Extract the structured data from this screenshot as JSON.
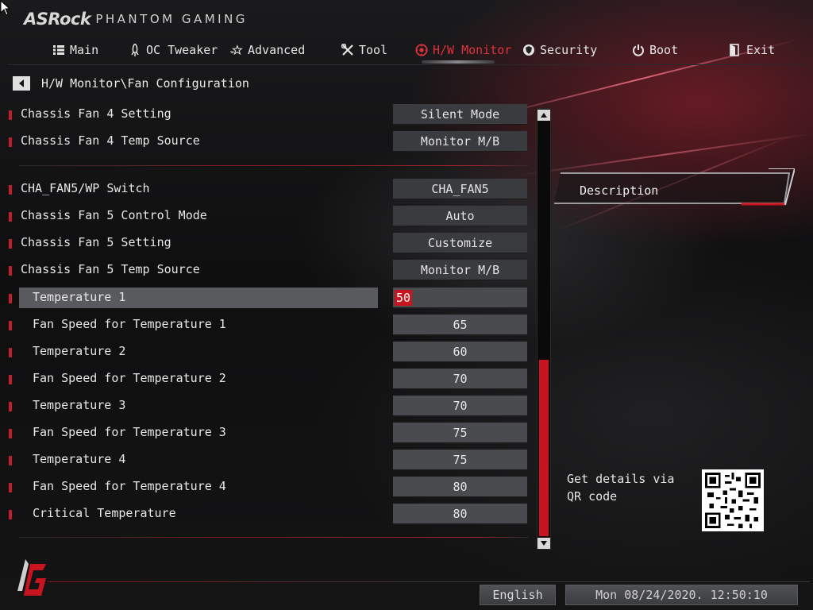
{
  "brand": {
    "name": "ASRock",
    "subtitle": "PHANTOM GAMING"
  },
  "nav": [
    {
      "label": "Main",
      "icon": "list-icon"
    },
    {
      "label": "OC Tweaker",
      "icon": "rocket-icon"
    },
    {
      "label": "Advanced",
      "icon": "star-icon"
    },
    {
      "label": "Tool",
      "icon": "tools-icon"
    },
    {
      "label": "H/W Monitor",
      "icon": "monitor-gauge-icon",
      "active": true
    },
    {
      "label": "Security",
      "icon": "shield-icon"
    },
    {
      "label": "Boot",
      "icon": "power-icon"
    },
    {
      "label": "Exit",
      "icon": "exit-icon"
    }
  ],
  "breadcrumb": "H/W Monitor\\Fan Configuration",
  "settings": [
    {
      "label": "Chassis Fan 4 Setting",
      "value": "Silent Mode"
    },
    {
      "label": "Chassis Fan 4 Temp Source",
      "value": "Monitor M/B"
    },
    {
      "label": "CHA_FAN5/WP Switch",
      "value": "CHA_FAN5"
    },
    {
      "label": "Chassis Fan 5 Control Mode",
      "value": "Auto"
    },
    {
      "label": "Chassis Fan 5 Setting",
      "value": "Customize"
    },
    {
      "label": "Chassis Fan 5 Temp Source",
      "value": "Monitor M/B"
    },
    {
      "label": "Temperature 1",
      "value": "50"
    },
    {
      "label": "Fan Speed for Temperature 1",
      "value": "65"
    },
    {
      "label": "Temperature 2",
      "value": "60"
    },
    {
      "label": "Fan Speed for Temperature 2",
      "value": "70"
    },
    {
      "label": "Temperature 3",
      "value": "70"
    },
    {
      "label": "Fan Speed for Temperature 3",
      "value": "75"
    },
    {
      "label": "Temperature 4",
      "value": "75"
    },
    {
      "label": "Fan Speed for Temperature 4",
      "value": "80"
    },
    {
      "label": "Critical Temperature",
      "value": "80"
    }
  ],
  "description": {
    "title": "Description"
  },
  "qr": {
    "text": "Get details via QR code"
  },
  "footer": {
    "language": "English",
    "datetime": "Mon 08/24/2020. 12:50:10"
  },
  "colors": {
    "accent": "#c8141f",
    "active_tab": "#e0323d"
  }
}
